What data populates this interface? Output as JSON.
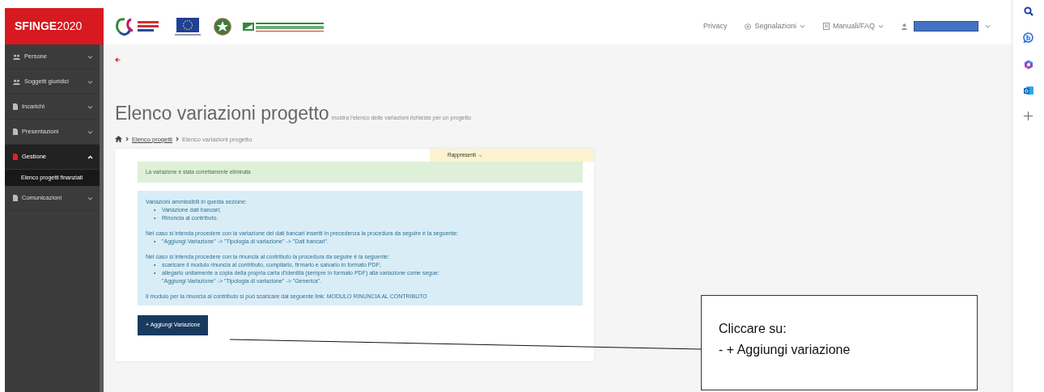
{
  "header": {
    "brand": {
      "bold": "SFINGE",
      "light": "2020"
    },
    "nav": [
      {
        "label": "Privacy",
        "kind": "link"
      },
      {
        "label": "Segnalazioni",
        "kind": "gear-menu"
      },
      {
        "label": "Manuali/FAQ",
        "kind": "book-menu"
      },
      {
        "kind": "user-menu"
      }
    ]
  },
  "sidebar": {
    "items": [
      {
        "label": "Persone",
        "kind": "people",
        "selected": false,
        "expanded": false
      },
      {
        "label": "Soggetti giuridici",
        "kind": "people",
        "selected": false,
        "expanded": false
      },
      {
        "label": "Incarichi",
        "kind": "document",
        "selected": false,
        "expanded": false
      },
      {
        "label": "Presentazioni",
        "kind": "document",
        "selected": false,
        "expanded": false
      },
      {
        "label": "Gestione",
        "kind": "document",
        "selected": true,
        "expanded": true,
        "children": [
          {
            "label": "Elenco progetti finanziati",
            "selected": true
          }
        ]
      },
      {
        "label": "Comunicazioni",
        "kind": "document",
        "selected": false,
        "expanded": false
      }
    ]
  },
  "page": {
    "title": "Elenco variazioni progetto",
    "subtitle": "mostra l'elenco delle variazioni richieste per un progetto",
    "breadcrumb": [
      {
        "label": "Elenco progetti",
        "kind": "link"
      },
      {
        "label": "Elenco variazioni progetto",
        "kind": "current"
      }
    ],
    "rappresenti": "Rappresenti →",
    "success_alert": "La variazione è stata correttamente eliminata",
    "info_blocks": [
      {
        "text": "Variazioni ammissibili in questa sezione:",
        "bullets": [
          {
            "marker": "•",
            "text": "Variazione dati bancari;"
          },
          {
            "marker": "•",
            "text": "Rinuncia al contributo."
          }
        ]
      },
      {
        "text": "Nel caso si intenda procedere con la variazione dei dati bancari inseriti in precedenza la procedura da seguire è la seguente:",
        "bullets": [
          {
            "marker": "•",
            "text": "\"Aggiungi Variazione\" -> \"Tipologia di variazione\" -> \"Dati bancari\"."
          }
        ]
      },
      {
        "text": "Nel caso si intenda procedere con la rinuncia al contributo la procedura da seguire è la seguente:",
        "bullets": [
          {
            "marker": "•",
            "text": "scaricare il modulo rinuncia al contributo, compilarlo, firmarlo e salvarlo in formato PDF;"
          },
          {
            "marker": "•",
            "text": "allegarlo unitamente a copia della propria carta d'identità (sempre in formato PDF) alla variazione come segue:\n\"Aggiungi Variazione\" -> \"Tipologia di variazione\" -> \"Generica\"."
          }
        ]
      }
    ],
    "download": {
      "text": "Il modulo per la rinuncia al contributo si può scaricare dal seguente link:",
      "link": "MODULO RINUNCIA AL CONTRIBUTO"
    },
    "add_button": "+ Aggiungi Variazione"
  },
  "callout": {
    "lines": [
      "Cliccare su:",
      "- + Aggiungi variazione"
    ]
  },
  "browser_sidebar": [
    {
      "kind": "search"
    },
    {
      "kind": "bing"
    },
    {
      "kind": "copilot"
    },
    {
      "kind": "outlook"
    },
    {
      "kind": "add"
    }
  ]
}
